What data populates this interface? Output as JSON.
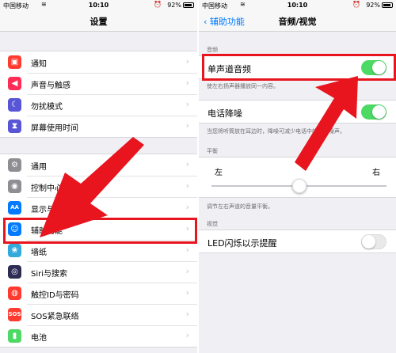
{
  "status": {
    "carrier": "中国移动",
    "time": "10:10",
    "battery": "92%"
  },
  "left": {
    "nav_title": "设置",
    "group1": [
      {
        "label": "通知",
        "icon": "bell-icon",
        "color": "#ff3b30",
        "glyph": "▣"
      },
      {
        "label": "声音与触感",
        "icon": "speaker-icon",
        "color": "#ff2d55",
        "glyph": "◀"
      },
      {
        "label": "勿扰模式",
        "icon": "moon-icon",
        "color": "#5856d6",
        "glyph": "☾"
      },
      {
        "label": "屏幕使用时间",
        "icon": "hourglass-icon",
        "color": "#5856d6",
        "glyph": "⧗"
      }
    ],
    "group2": [
      {
        "label": "通用",
        "icon": "gear-icon",
        "color": "#8e8e93",
        "glyph": "⚙"
      },
      {
        "label": "控制中心",
        "icon": "toggles-icon",
        "color": "#8e8e93",
        "glyph": "◉"
      },
      {
        "label": "显示与亮度",
        "icon": "text-size-icon",
        "color": "#007aff",
        "glyph": "AA"
      },
      {
        "label": "辅助功能",
        "icon": "accessibility-icon",
        "color": "#007aff",
        "glyph": "☺"
      },
      {
        "label": "墙纸",
        "icon": "flower-icon",
        "color": "#34aadc",
        "glyph": "❀"
      },
      {
        "label": "Siri与搜索",
        "icon": "siri-icon",
        "color": "#2c2c54",
        "glyph": "◎"
      },
      {
        "label": "触控ID与密码",
        "icon": "fingerprint-icon",
        "color": "#ff3b30",
        "glyph": "◍"
      },
      {
        "label": "SOS紧急联络",
        "icon": "sos-icon",
        "color": "#ff3b30",
        "glyph": "SOS"
      },
      {
        "label": "电池",
        "icon": "battery-icon",
        "color": "#4cd964",
        "glyph": "▮"
      }
    ]
  },
  "right": {
    "back_label": "辅助功能",
    "nav_title": "音频/视觉",
    "section_audio": "音频",
    "mono_audio_label": "单声道音频",
    "mono_audio_note": "使左右扬声器播放同一内容。",
    "noise_label": "电话降噪",
    "noise_note": "当您将听筒放在耳边时，降噪可减少电话中的环境噪声。",
    "section_balance": "平衡",
    "balance_left": "左",
    "balance_right": "右",
    "balance_level": 0.5,
    "balance_note": "调节左右声道的音量平衡。",
    "section_visual": "视觉",
    "led_label": "LED闪烁以示提醒"
  },
  "colors": {
    "highlight": "#e8141e",
    "toggle_on": "#4cd964",
    "ios_blue": "#007aff"
  }
}
